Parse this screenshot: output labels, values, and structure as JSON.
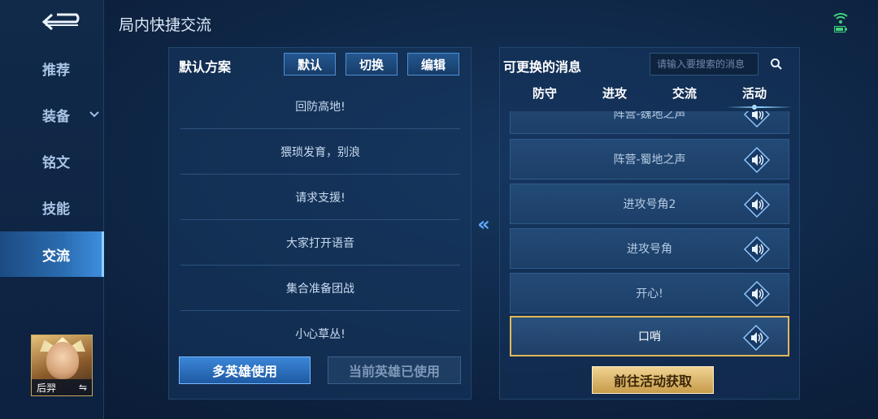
{
  "header": {
    "title": "局内快捷交流"
  },
  "sidebar": {
    "items": [
      {
        "label": "推荐"
      },
      {
        "label": "装备"
      },
      {
        "label": "铭文"
      },
      {
        "label": "技能"
      },
      {
        "label": "交流"
      }
    ],
    "hero": {
      "name": "后羿",
      "swap_symbol": "⇋"
    }
  },
  "left_panel": {
    "title": "默认方案",
    "buttons": {
      "default": "默认",
      "switch": "切换",
      "edit": "编辑"
    },
    "messages": [
      "回防高地!",
      "猥琐发育，别浪",
      "请求支援!",
      "大家打开语音",
      "集合准备团战",
      "小心草丛!"
    ],
    "multi_hero_button": "多英雄使用",
    "current_hero_used_button": "当前英雄已使用"
  },
  "transfer": {
    "symbol": "«"
  },
  "right_panel": {
    "title": "可更换的消息",
    "search_placeholder": "请输入要搜索的消息",
    "tabs": [
      "防守",
      "进攻",
      "交流",
      "活动"
    ],
    "active_tab": "活动",
    "sounds": [
      "阵营-魏地之声",
      "阵营-蜀地之声",
      "进攻号角2",
      "进攻号角",
      "开心!",
      "口哨"
    ],
    "selected_sound": "口哨",
    "goto_button": "前往活动获取"
  },
  "colors": {
    "accent": "#3f8fe0",
    "gold": "#e2b85a",
    "panel": "#16365f"
  },
  "icons": {
    "back": "back-arrow-icon",
    "search": "search-icon",
    "speaker": "speaker-icon",
    "wifi": "wifi-icon",
    "battery": "battery-icon"
  }
}
